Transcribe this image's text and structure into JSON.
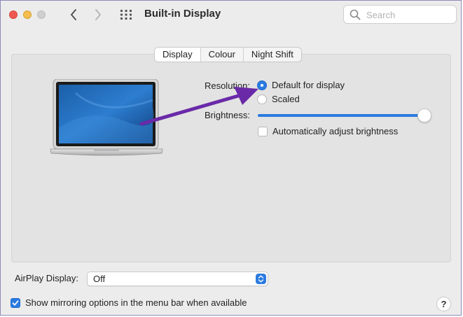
{
  "window": {
    "title": "Built-in Display"
  },
  "search": {
    "placeholder": "Search",
    "value": ""
  },
  "tabs": [
    {
      "label": "Display",
      "active": true
    },
    {
      "label": "Colour",
      "active": false
    },
    {
      "label": "Night Shift",
      "active": false
    }
  ],
  "display": {
    "resolution_label": "Resolution:",
    "options": [
      {
        "label": "Default for display",
        "selected": true
      },
      {
        "label": "Scaled",
        "selected": false
      }
    ],
    "brightness_label": "Brightness:",
    "brightness_level": 1.0,
    "auto_brightness": {
      "label": "Automatically adjust brightness",
      "checked": false
    }
  },
  "airplay": {
    "label": "AirPlay Display:",
    "selected": "Off"
  },
  "mirroring": {
    "label": "Show mirroring options in the menu bar when available",
    "checked": true
  },
  "help": {
    "label": "?"
  },
  "colors": {
    "accent": "#2b7be0",
    "annotation_arrow": "#6a2aa8"
  },
  "icons": {
    "back": "chevron-left-icon",
    "forward": "chevron-right-icon",
    "show_all": "grid-icon",
    "search": "search-icon"
  }
}
